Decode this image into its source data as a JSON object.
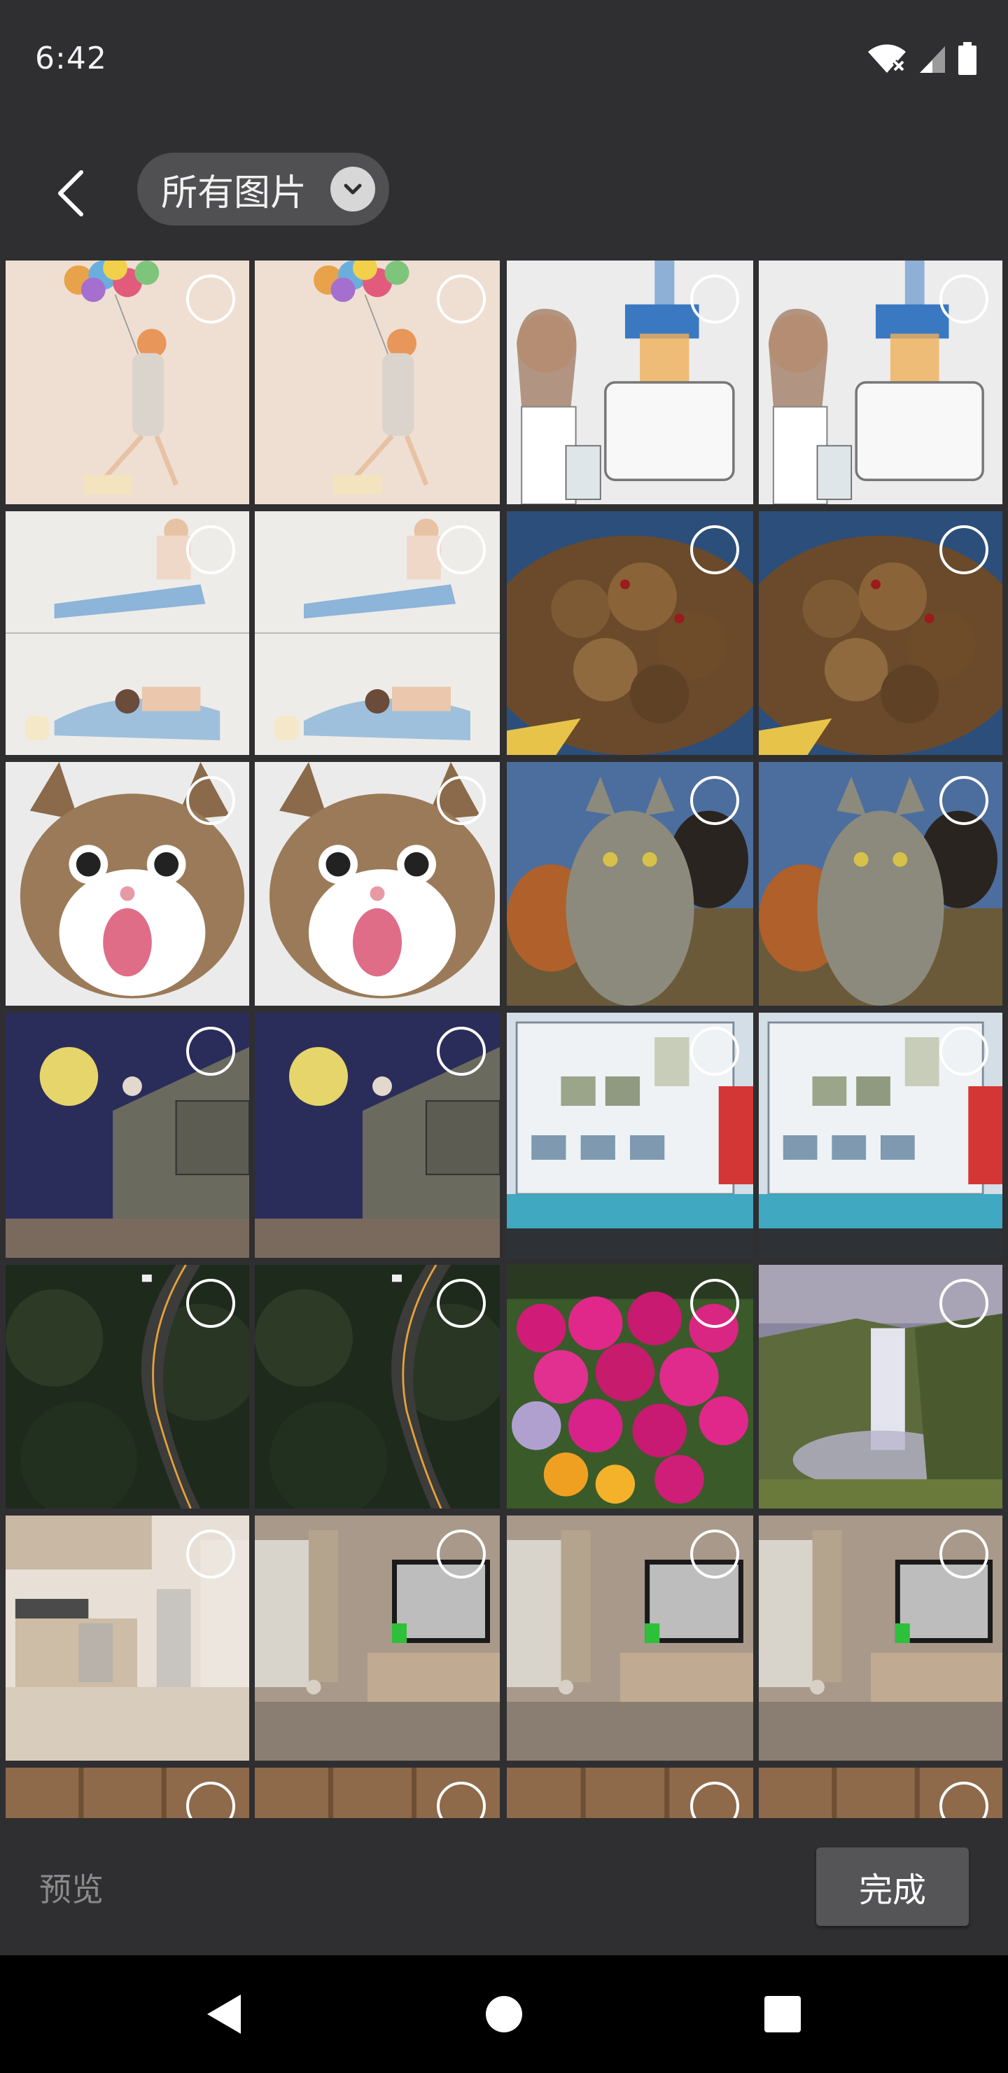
{
  "status": {
    "time": "6:42"
  },
  "header": {
    "album_label": "所有图片"
  },
  "grid": {
    "items": [
      {
        "subject": "balloon-girl-illustration"
      },
      {
        "subject": "balloon-girl-illustration"
      },
      {
        "subject": "toaster-head-cartoon"
      },
      {
        "subject": "toaster-head-cartoon"
      },
      {
        "subject": "stretching-man-cartoon"
      },
      {
        "subject": "stretching-man-cartoon"
      },
      {
        "subject": "braised-meat-dish"
      },
      {
        "subject": "braised-meat-dish"
      },
      {
        "subject": "surprised-cat"
      },
      {
        "subject": "surprised-cat"
      },
      {
        "subject": "cat-and-dogs-selfie"
      },
      {
        "subject": "cat-and-dogs-selfie"
      },
      {
        "subject": "night-house-moon-illustration"
      },
      {
        "subject": "night-house-moon-illustration"
      },
      {
        "subject": "bulletin-board-photo"
      },
      {
        "subject": "bulletin-board-photo"
      },
      {
        "subject": "forest-road-aerial"
      },
      {
        "subject": "forest-road-aerial"
      },
      {
        "subject": "pink-flowers"
      },
      {
        "subject": "waterfall-landscape"
      },
      {
        "subject": "kitchen-render"
      },
      {
        "subject": "living-room-tv-render"
      },
      {
        "subject": "living-room-tv-render"
      },
      {
        "subject": "living-room-tv-render"
      },
      {
        "subject": "wood-interior-partial"
      },
      {
        "subject": "wood-interior-partial"
      },
      {
        "subject": "wood-interior-partial"
      },
      {
        "subject": "wood-interior-partial"
      }
    ]
  },
  "bottom": {
    "preview_label": "预览",
    "done_label": "完成"
  },
  "icons": {
    "back": "back-arrow-icon",
    "dropdown": "chevron-down-icon",
    "wifi": "wifi-off-icon",
    "signal": "signal-icon",
    "battery": "battery-icon",
    "nav_back": "nav-back-icon",
    "nav_home": "nav-home-icon",
    "nav_recents": "nav-recents-icon"
  }
}
